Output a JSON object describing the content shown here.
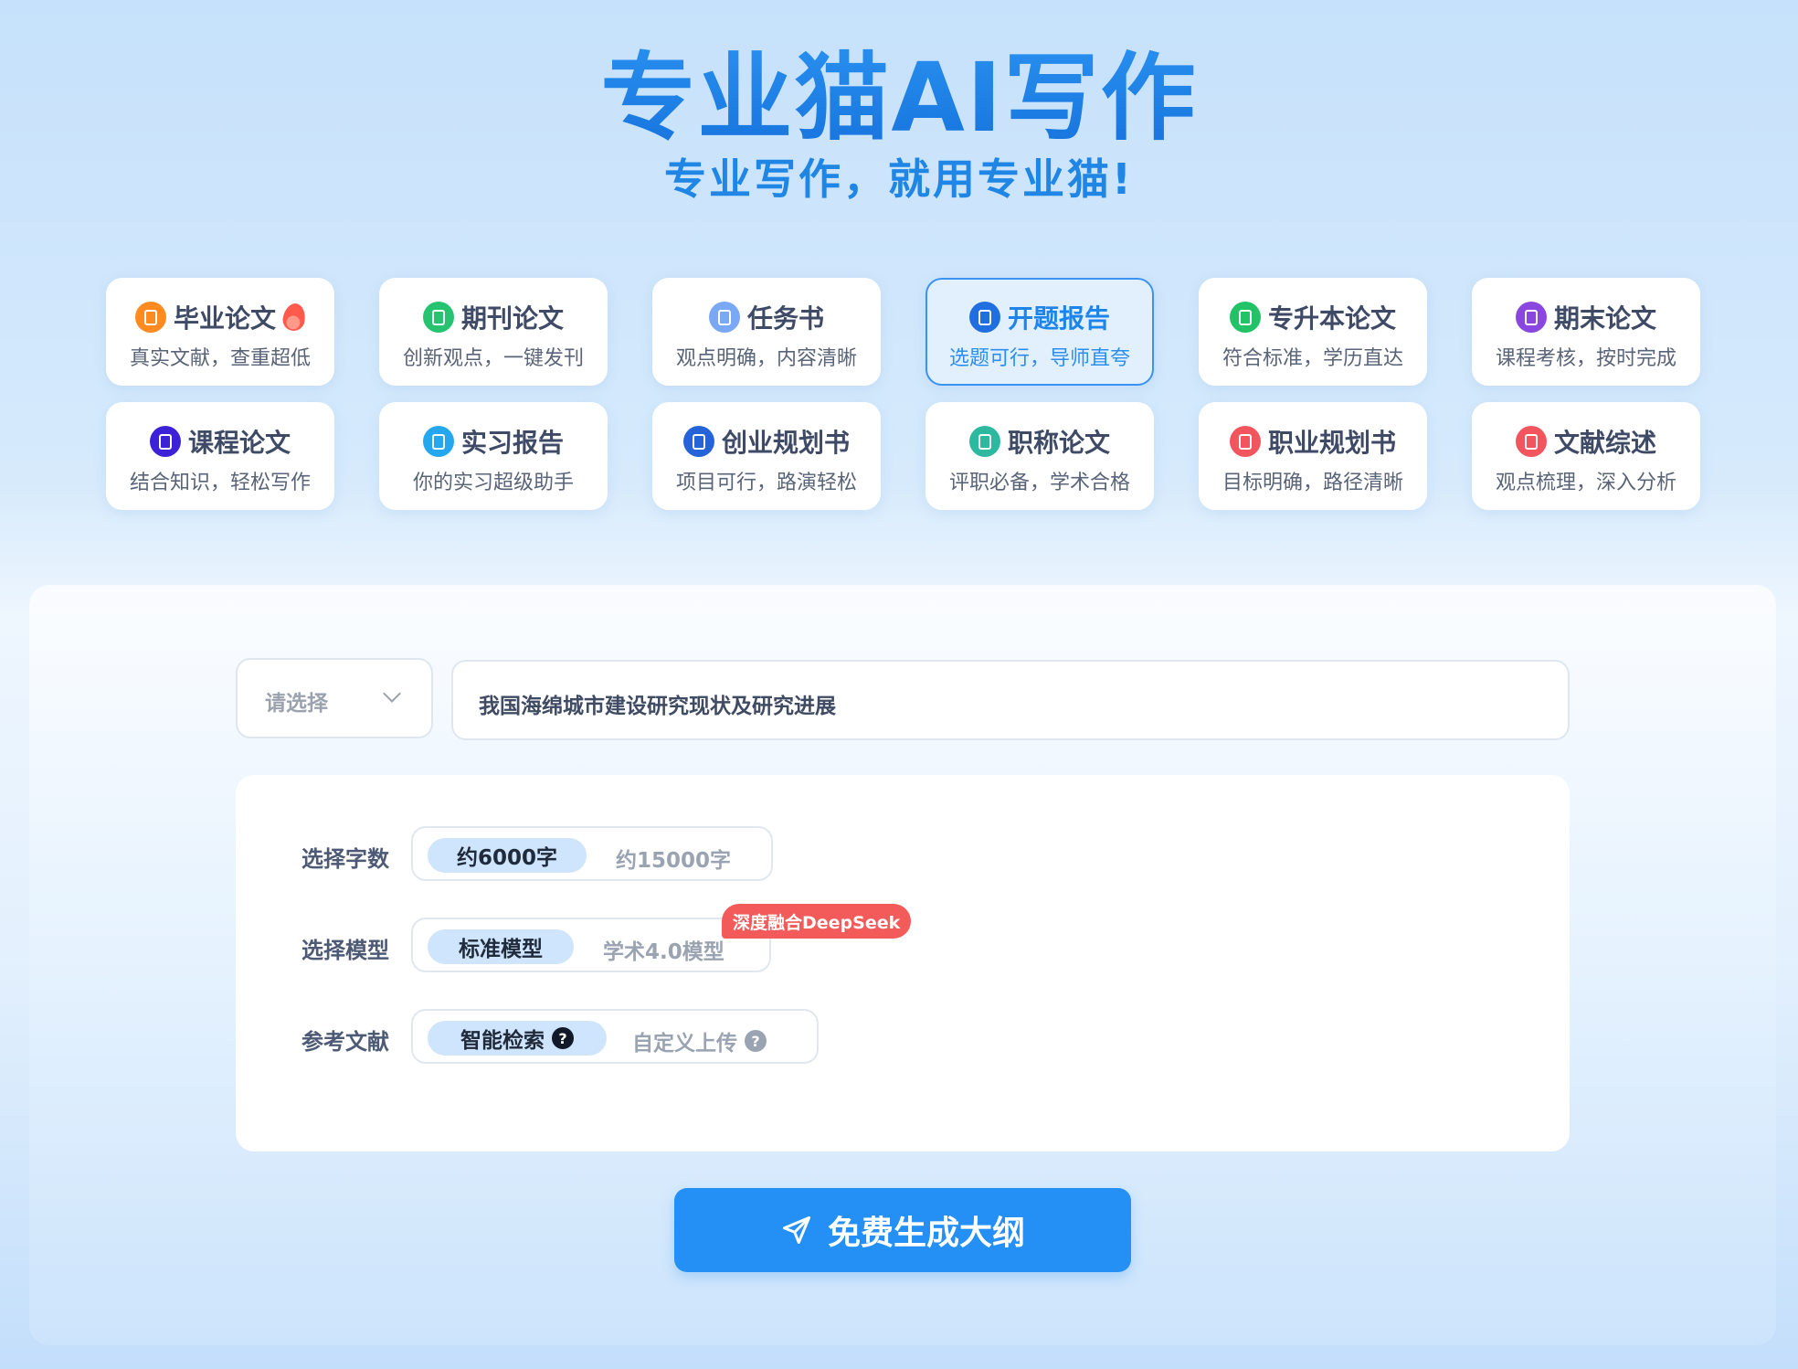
{
  "hero": {
    "title": "专业猫AI写作",
    "subtitle": "专业写作，就用专业猫!"
  },
  "categories": [
    {
      "name": "毕业论文",
      "desc": "真实文献，查重超低",
      "icon": "orange-doc-icon",
      "color": "#ff8a1f",
      "hot": true,
      "active": false
    },
    {
      "name": "期刊论文",
      "desc": "创新观点，一键发刊",
      "icon": "green-doc-icon",
      "color": "#28c371",
      "active": false
    },
    {
      "name": "任务书",
      "desc": "观点明确，内容清晰",
      "icon": "checklist-icon",
      "color": "#7aa8f5",
      "active": false
    },
    {
      "name": "开题报告",
      "desc": "选题可行，导师直夸",
      "icon": "report-icon",
      "color": "#1f6fe0",
      "active": true
    },
    {
      "name": "专升本论文",
      "desc": "符合标准，学历直达",
      "icon": "book-icon",
      "color": "#22c266",
      "active": false
    },
    {
      "name": "期末论文",
      "desc": "课程考核，按时完成",
      "icon": "purple-doc-icon",
      "color": "#8a47e0",
      "active": false
    },
    {
      "name": "课程论文",
      "desc": "结合知识，轻松写作",
      "icon": "save-doc-icon",
      "color": "#3b22d6",
      "active": false
    },
    {
      "name": "实习报告",
      "desc": "你的实习超级助手",
      "icon": "notes-icon",
      "color": "#25a7f0",
      "active": false
    },
    {
      "name": "创业规划书",
      "desc": "项目可行，路演轻松",
      "icon": "id-doc-icon",
      "color": "#2563d9",
      "active": false
    },
    {
      "name": "职称论文",
      "desc": "评职必备，学术合格",
      "icon": "teal-doc-icon",
      "color": "#2db8a0",
      "active": false
    },
    {
      "name": "职业规划书",
      "desc": "目标明确，路径清晰",
      "icon": "red-stack-icon",
      "color": "#f2555e",
      "active": false
    },
    {
      "name": "文献综述",
      "desc": "观点梳理，深入分析",
      "icon": "red-stack-icon",
      "color": "#f2555e",
      "active": false
    }
  ],
  "form": {
    "type_select_placeholder": "请选择",
    "topic_value": "我国海绵城市建设研究现状及研究进展",
    "word_count": {
      "label": "选择字数",
      "options": [
        "约6000字",
        "约15000字"
      ],
      "selected": "约6000字"
    },
    "model": {
      "label": "选择模型",
      "options": [
        "标准模型",
        "学术4.0模型"
      ],
      "selected": "标准模型",
      "badge": "深度融合DeepSeek"
    },
    "references": {
      "label": "参考文献",
      "options": [
        "智能检索",
        "自定义上传"
      ],
      "selected": "智能检索"
    },
    "submit_label": "免费生成大纲"
  }
}
